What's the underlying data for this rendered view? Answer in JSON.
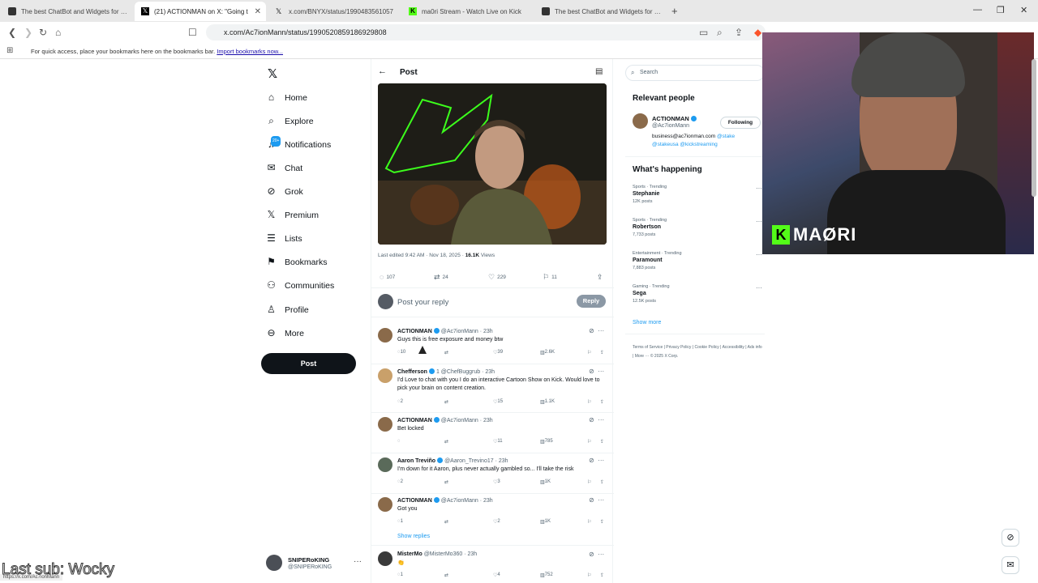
{
  "browser": {
    "tabs": [
      {
        "title": "The best ChatBot and Widgets for Kick",
        "favicon": "botrix-icon",
        "active": false
      },
      {
        "title": "(21) ACTIONMAN on X: \"Going t",
        "favicon": "x-logo-icon",
        "active": true
      },
      {
        "title": "x.com/BNYX/status/1990483561057",
        "favicon": "x-logo-icon",
        "active": false
      },
      {
        "title": "ma0ri Stream - Watch Live on Kick",
        "favicon": "kick-icon",
        "active": false
      },
      {
        "title": "The best ChatBot and Widgets for Kick",
        "favicon": "botrix-icon",
        "active": false
      }
    ],
    "new_tab": "+",
    "url": "x.com/Ac7ionMann/status/1990520859186929808",
    "bookmarks_msg": "For quick access, place your bookmarks here on the bookmarks bar.",
    "bookmarks_link": "Import bookmarks now..."
  },
  "nav": {
    "items": [
      {
        "label": "Home",
        "icon": "home-icon"
      },
      {
        "label": "Explore",
        "icon": "search-icon"
      },
      {
        "label": "Notifications",
        "icon": "bell-icon",
        "badge": "20+"
      },
      {
        "label": "Chat",
        "icon": "mail-icon"
      },
      {
        "label": "Grok",
        "icon": "grok-icon"
      },
      {
        "label": "Premium",
        "icon": "x-logo-icon"
      },
      {
        "label": "Lists",
        "icon": "list-icon"
      },
      {
        "label": "Bookmarks",
        "icon": "bookmark-icon"
      },
      {
        "label": "Communities",
        "icon": "people-icon"
      },
      {
        "label": "Profile",
        "icon": "person-icon"
      },
      {
        "label": "More",
        "icon": "more-circle-icon"
      }
    ],
    "post_button": "Post",
    "account": {
      "name": "SNIPERoKING",
      "handle": "@SNIPERoKING"
    }
  },
  "post": {
    "header_title": "Post",
    "meta_prefix": "Last edited 9:42 AM · Nov 18, 2025 · ",
    "views_count": "16.1K",
    "views_label": " Views",
    "stats": {
      "replies": "107",
      "reposts": "24",
      "likes": "229",
      "bookmarks": "11"
    },
    "reply_placeholder": "Post your reply",
    "reply_button": "Reply"
  },
  "replies": [
    {
      "name": "ACTIONMAN",
      "verified": true,
      "handle": "@Ac7ionMann · 23h",
      "text": "Guys this is free exposure and money btw",
      "replies": "10",
      "reposts": "",
      "likes": "39",
      "views": "2.6K",
      "avatar_color": "#8a6a4a"
    },
    {
      "name": "Chefferson",
      "verified": true,
      "handle": "1 @ChefBuggrub · 23h",
      "text": "I'd Love to chat with you I do an interactive Cartoon Show on Kick. Would love to pick your brain on content creation.",
      "replies": "2",
      "reposts": "",
      "likes": "15",
      "views": "1.1K",
      "avatar_color": "#c9a06a"
    },
    {
      "name": "ACTIONMAN",
      "verified": true,
      "handle": "@Ac7ionMann · 23h",
      "text": "Bet locked",
      "replies": "",
      "reposts": "",
      "likes": "11",
      "views": "785",
      "avatar_color": "#8a6a4a"
    },
    {
      "name": "Aaron Treviño",
      "verified": true,
      "handle": "@Aaron_Trevino17 · 23h",
      "text": "I'm down for it Aaron, plus never actually gambled so... I'll take the risk",
      "replies": "2",
      "reposts": "",
      "likes": "3",
      "views": "1K",
      "avatar_color": "#5a6a5a"
    },
    {
      "name": "ACTIONMAN",
      "verified": true,
      "handle": "@Ac7ionMann · 23h",
      "text": "Got you",
      "replies": "1",
      "reposts": "",
      "likes": "2",
      "views": "1K",
      "avatar_color": "#8a6a4a"
    },
    {
      "name": "MisterMo",
      "verified": false,
      "handle": "@MisterMo360 · 23h",
      "text": "👏",
      "replies": "1",
      "reposts": "",
      "likes": "4",
      "views": "752",
      "avatar_color": "#3a3a3a"
    }
  ],
  "show_replies": "Show replies",
  "sidebar": {
    "search_placeholder": "Search",
    "relevant_title": "Relevant people",
    "person": {
      "name": "ACTIONMAN",
      "handle": "@Ac7ionMann",
      "follow_label": "Following",
      "bio_prefix": "business@ac7ionman.com ",
      "bio_links": "@stake",
      "bio_links2": "@stakeusa @kickstreaming"
    },
    "happening_title": "What's happening",
    "trends": [
      {
        "category": "Sports · Trending",
        "title": "Stephanie",
        "posts": "12K posts"
      },
      {
        "category": "Sports · Trending",
        "title": "Robertson",
        "posts": "7,733 posts"
      },
      {
        "category": "Entertainment · Trending",
        "title": "Paramount",
        "posts": "7,883 posts"
      },
      {
        "category": "Gaming · Trending",
        "title": "Sega",
        "posts": "12.5K posts"
      }
    ],
    "show_more": "Show more",
    "footer": "Terms of Service | Privacy Policy | Cookie Policy | Accessibility | Ads info | More ··· © 2025 X Corp."
  },
  "overlay": {
    "webcam_logo": "MAØRI",
    "kick_letter": "K",
    "last_sub": "Last sub: Wocky",
    "status_url": "https://x.com/Ac7ionMann"
  }
}
